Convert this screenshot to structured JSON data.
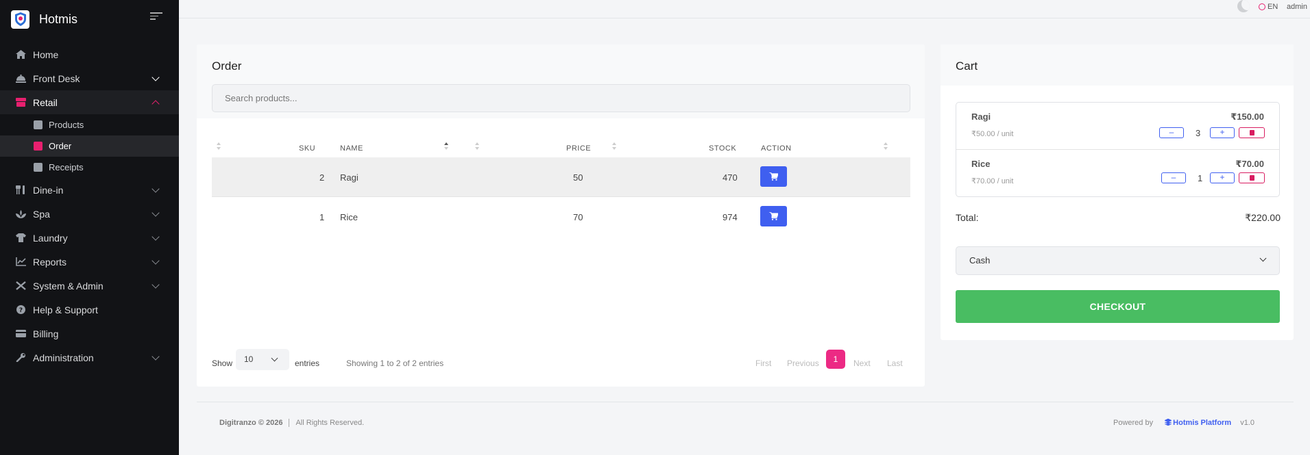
{
  "sidebar": {
    "brand": "Hotmis",
    "items": [
      {
        "label": "Home"
      },
      {
        "label": "Front Desk"
      },
      {
        "label": "Retail"
      },
      {
        "label": "Dine-in"
      },
      {
        "label": "Spa"
      },
      {
        "label": "Laundry"
      },
      {
        "label": "Reports"
      },
      {
        "label": "System & Admin"
      },
      {
        "label": "Help & Support"
      },
      {
        "label": "Billing"
      },
      {
        "label": "Administration"
      }
    ],
    "retail_sub": [
      {
        "label": "Products"
      },
      {
        "label": "Order"
      },
      {
        "label": "Receipts"
      }
    ]
  },
  "topbar": {
    "lang": "EN",
    "user": "admin"
  },
  "order": {
    "title": "Order",
    "search_placeholder": "Search products...",
    "columns": {
      "sku": "SKU",
      "name": "NAME",
      "price": "PRICE",
      "stock": "STOCK",
      "action": "ACTION"
    },
    "rows": [
      {
        "sku": "2",
        "name": "Ragi",
        "price": "50",
        "stock": "470"
      },
      {
        "sku": "1",
        "name": "Rice",
        "price": "70",
        "stock": "974"
      }
    ],
    "show_label": "Show",
    "entries_value": "10",
    "entries_label": "entries",
    "info": "Showing 1 to 2 of 2 entries",
    "pager": {
      "first": "First",
      "previous": "Previous",
      "page": "1",
      "next": "Next",
      "last": "Last"
    }
  },
  "cart": {
    "title": "Cart",
    "items": [
      {
        "name": "Ragi",
        "unit": "₹50.00 / unit",
        "price": "₹150.00",
        "qty": "3"
      },
      {
        "name": "Rice",
        "unit": "₹70.00 / unit",
        "price": "₹70.00",
        "qty": "1"
      }
    ],
    "total_label": "Total:",
    "total_value": "₹220.00",
    "payment_method": "Cash",
    "checkout_label": "CHECKOUT"
  },
  "footer": {
    "company": "Digitranzo © 2026",
    "rights": "All Rights Reserved.",
    "powered_by": "Powered by",
    "platform": "Hotmis Platform",
    "version": "v1.0"
  },
  "colors": {
    "sidebar_bg": "#121316",
    "accent_pink": "#e8206f",
    "primary_blue": "#3f5ff0",
    "checkout_green": "#49bd62"
  }
}
